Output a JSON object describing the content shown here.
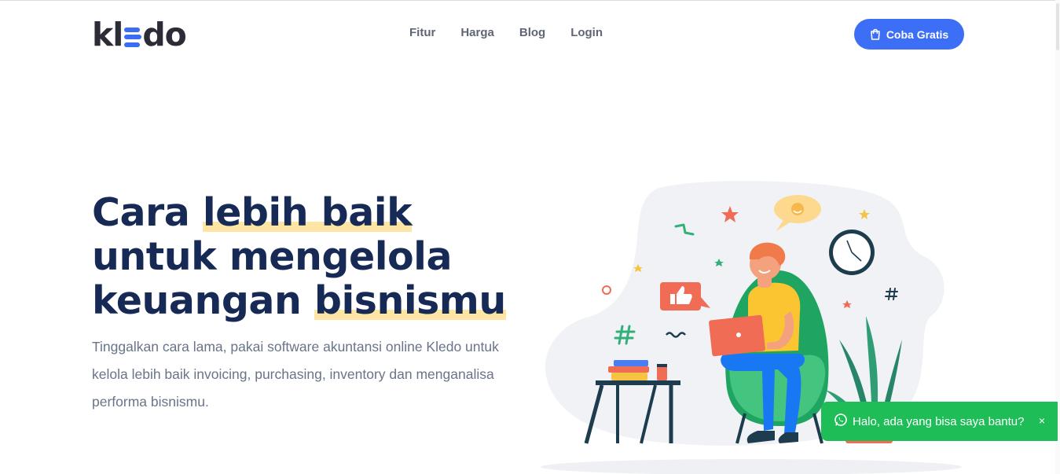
{
  "brand": {
    "logo_prefix": "kl",
    "logo_suffix": "do",
    "logo_accent_color": "#3a6cf4"
  },
  "nav": {
    "items": [
      {
        "label": "Fitur"
      },
      {
        "label": "Harga"
      },
      {
        "label": "Blog"
      },
      {
        "label": "Login"
      }
    ]
  },
  "cta": {
    "label": "Coba Gratis",
    "icon": "shopping-bag-icon",
    "color": "#3c6ef6"
  },
  "hero": {
    "title_line1_plain": "Cara ",
    "title_line1_highlight": "lebih baik",
    "title_line2": "untuk mengelola",
    "title_line3_plain": "keuangan ",
    "title_line3_highlight": "bisnismu",
    "highlight_color": "#fde6a3",
    "description": "Tinggalkan cara lama, pakai software akuntansi online Kledo untuk kelola lebih baik invoicing, purchasing, inventory dan menganalisa performa bisnismu."
  },
  "whatsapp": {
    "icon": "whatsapp-icon",
    "label": "Halo, ada yang bisa saya bantu?",
    "close_label": "×",
    "color": "#1ebd58"
  }
}
